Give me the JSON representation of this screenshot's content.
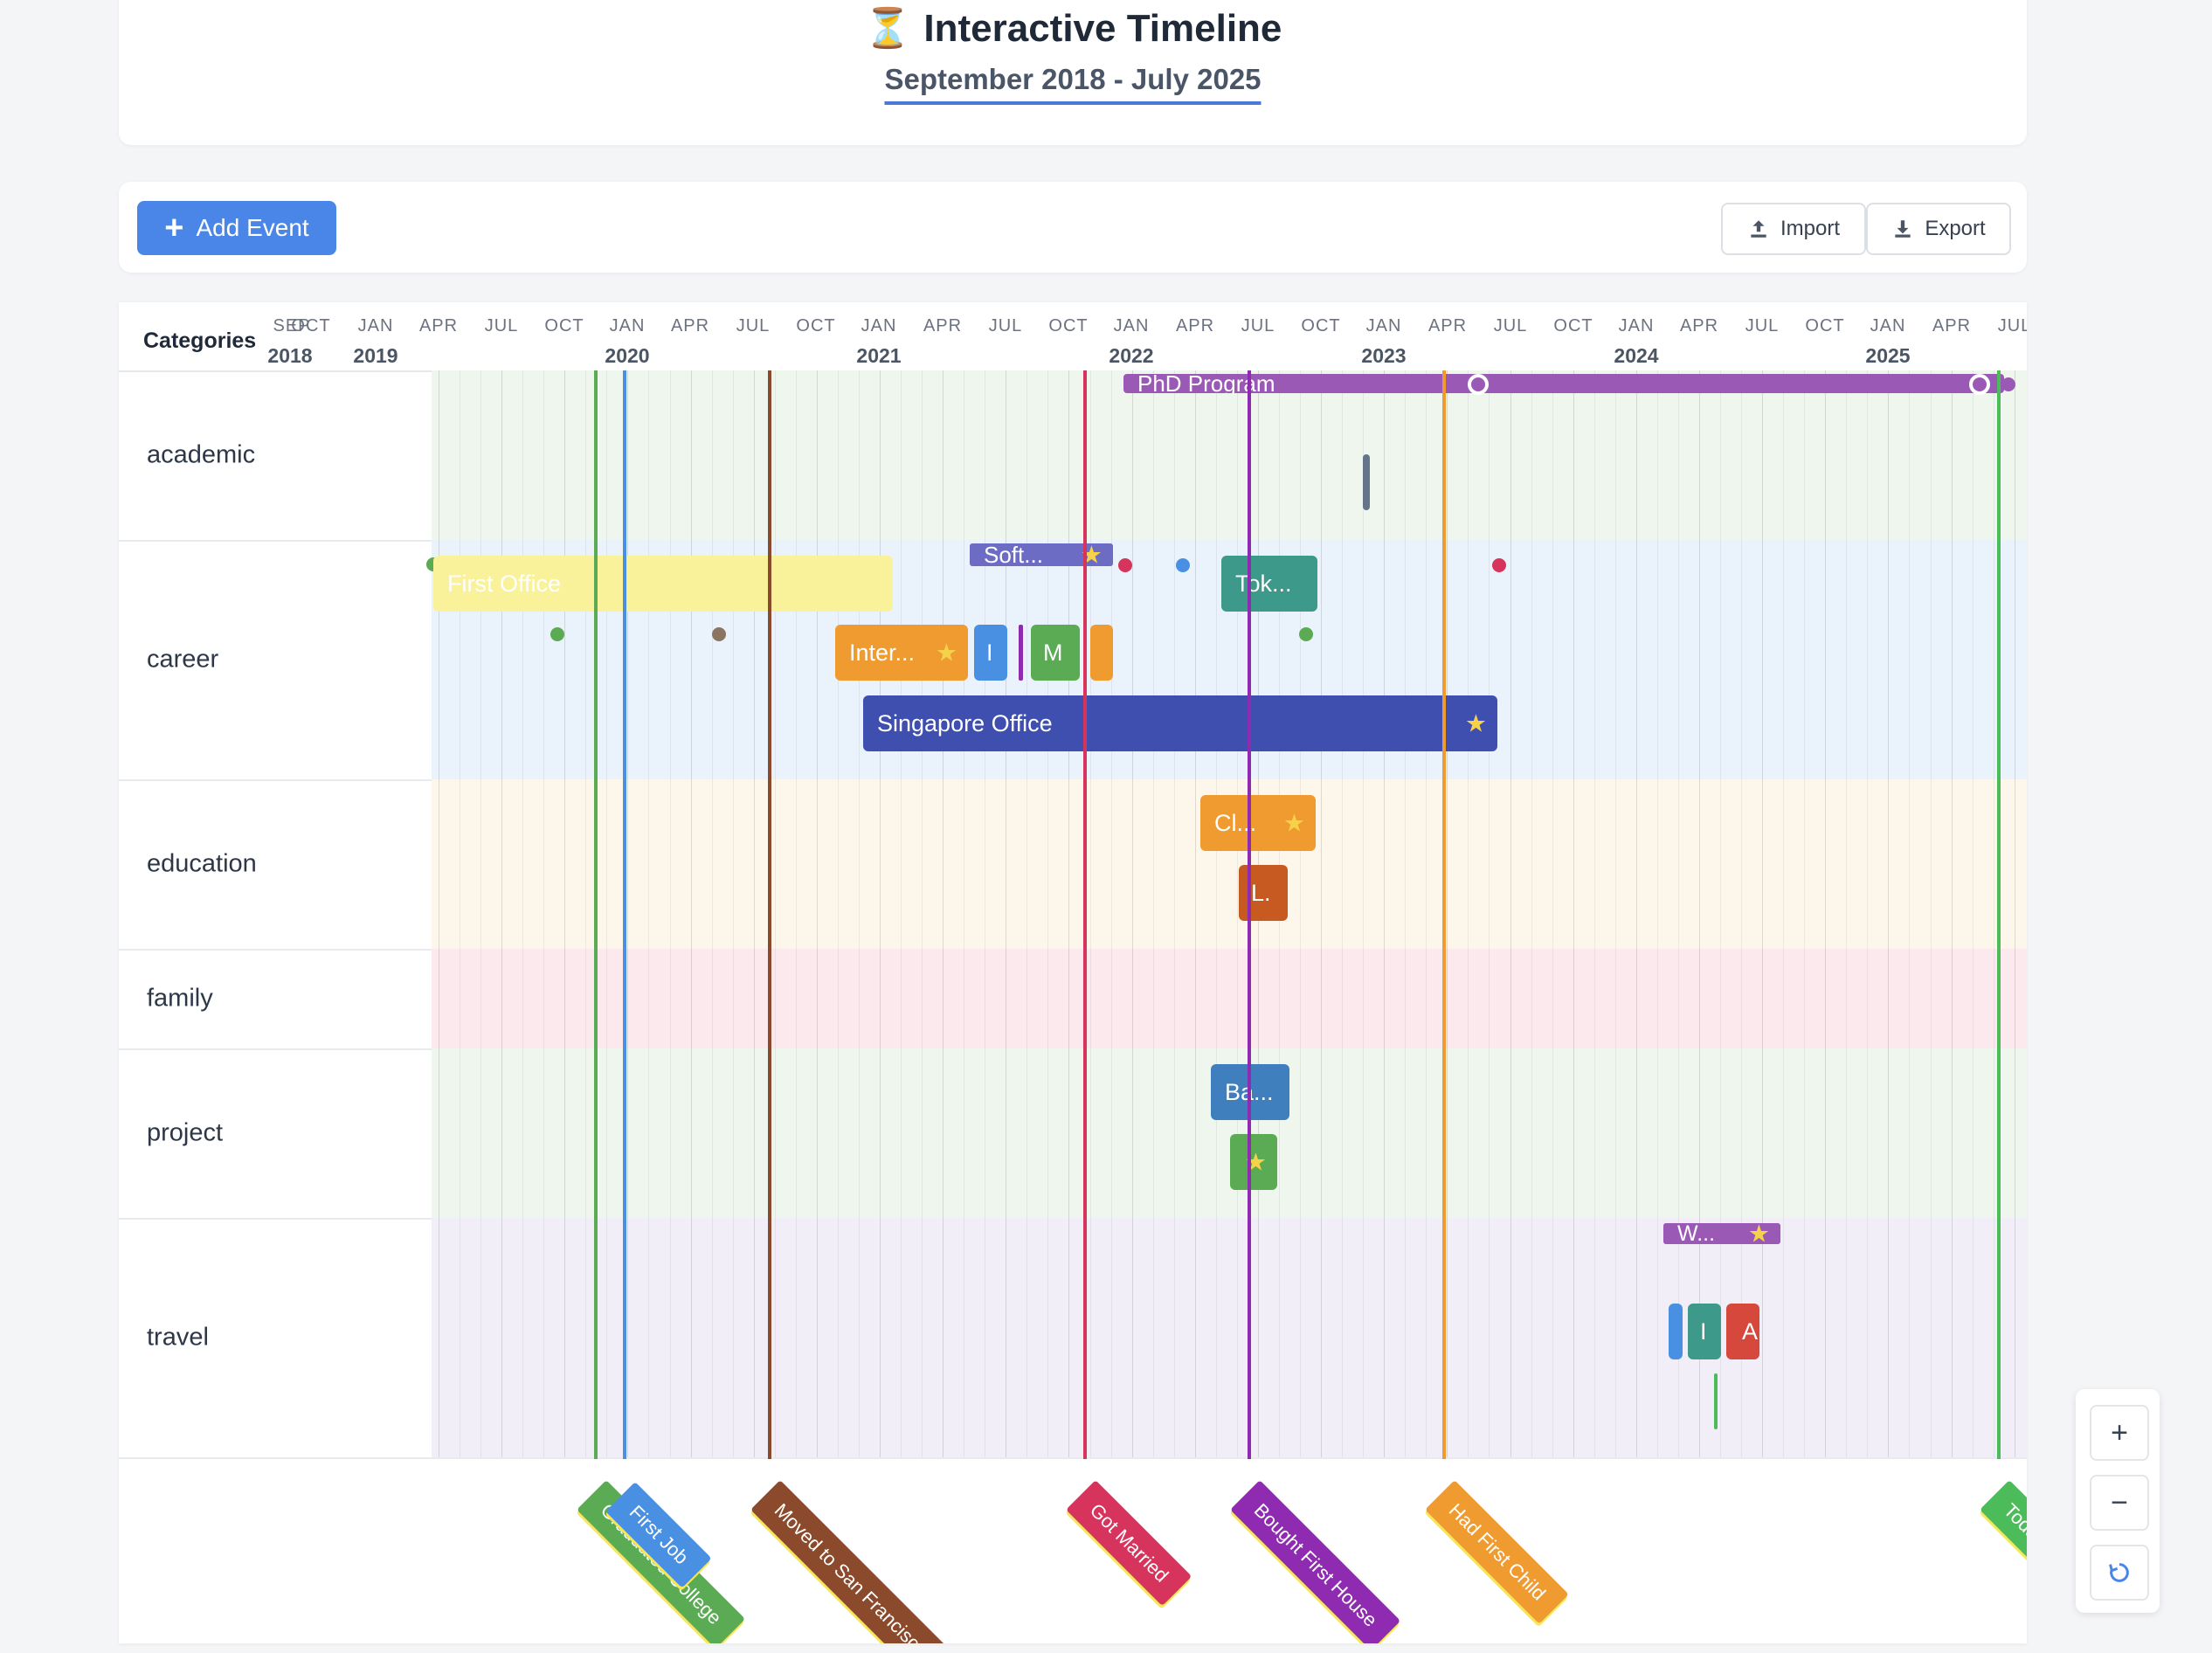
{
  "header": {
    "icon": "hourglass-icon",
    "title": "Interactive Timeline",
    "subtitle": "September 2018 - July 2025"
  },
  "toolbar": {
    "add_label": "Add Event",
    "import_label": "Import",
    "export_label": "Export"
  },
  "axis": {
    "categories_label": "Categories",
    "months": [
      "SEP",
      "OCT",
      "JAN",
      "APR",
      "JUL",
      "OCT",
      "JAN",
      "APR",
      "JUL",
      "OCT",
      "JAN",
      "APR",
      "JUL",
      "OCT",
      "JAN",
      "APR",
      "JUL",
      "OCT",
      "JAN",
      "APR",
      "JUL",
      "OCT",
      "JAN",
      "APR",
      "JUL",
      "OCT",
      "JAN",
      "APR",
      "JUL"
    ],
    "years": [
      "2018",
      "2019",
      "2020",
      "2021",
      "2022",
      "2023",
      "2024",
      "2025"
    ]
  },
  "rows": [
    {
      "name": "academic",
      "label": "academic",
      "bg": "#eef6ee"
    },
    {
      "name": "career",
      "label": "career",
      "bg": "#eaf2fb"
    },
    {
      "name": "education",
      "label": "education",
      "bg": "#fdf6ea"
    },
    {
      "name": "family",
      "label": "family",
      "bg": "#fce9ee"
    },
    {
      "name": "project",
      "label": "project",
      "bg": "#eef6ee"
    },
    {
      "name": "travel",
      "label": "travel",
      "bg": "#f1eef7"
    }
  ],
  "events": {
    "phd": "PhD Program",
    "first_office": "First Office",
    "soft": "Soft...",
    "tok": "Tok...",
    "inter": "Inter...",
    "i_career": "I",
    "m_career": "M",
    "singapore": "Singapore Office",
    "cl": "Cl...",
    "l_edu": "L.",
    "ba": "Ba...",
    "w_travel": "W...",
    "i_travel": "I",
    "a_travel": "A"
  },
  "milestones": [
    {
      "name": "graduated-college",
      "label": "Graduated College",
      "color": "#5aab54"
    },
    {
      "name": "first-job",
      "label": "First Job",
      "color": "#4a90e2"
    },
    {
      "name": "moved-to-san-francisco",
      "label": "Moved to San Francisco",
      "color": "#8b4a2b"
    },
    {
      "name": "got-married",
      "label": "Got Married",
      "color": "#d6345c"
    },
    {
      "name": "bought-first-house",
      "label": "Bought First House",
      "color": "#8e2bb0"
    },
    {
      "name": "had-first-child",
      "label": "Had First Child",
      "color": "#f09b30"
    },
    {
      "name": "today",
      "label": "Today",
      "color": "#4cbb5a"
    }
  ],
  "zoom": {
    "in_icon": "plus-icon",
    "out_icon": "minus-icon",
    "reset_icon": "reset-icon"
  }
}
